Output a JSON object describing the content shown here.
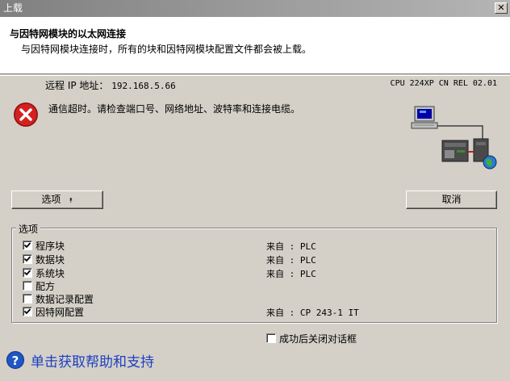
{
  "window": {
    "title": "上载",
    "close_glyph": "✕"
  },
  "header": {
    "title": "与因特网模块的以太网连接",
    "subtitle": "与因特网模块连接时，所有的块和因特网模块配置文件都会被上载。"
  },
  "connection": {
    "ip_label": "远程 IP 地址：",
    "ip_value": "192.168.5.66",
    "cpu_info": "CPU 224XP CN REL 02.01"
  },
  "error": {
    "icon": "error-icon",
    "message": "通信超时。请检查端口号、网络地址、波特率和连接电缆。"
  },
  "buttons": {
    "options_label": "选项",
    "options_arrow": "⯭",
    "cancel_label": "取消"
  },
  "options": {
    "group_label": "选项",
    "items": [
      {
        "label": "程序块",
        "checked": true,
        "from": "来自 : PLC"
      },
      {
        "label": "数据块",
        "checked": true,
        "from": "来自 : PLC"
      },
      {
        "label": "系统块",
        "checked": true,
        "from": "来自 : PLC"
      },
      {
        "label": "配方",
        "checked": false,
        "from": ""
      },
      {
        "label": "数据记录配置",
        "checked": false,
        "from": ""
      },
      {
        "label": "因特网配置",
        "checked": true,
        "from": "来自 : CP 243-1 IT"
      }
    ]
  },
  "close_after": {
    "label": "成功后关闭对话框",
    "checked": false
  },
  "help": {
    "icon_glyph": "?",
    "text": "单击获取帮助和支持"
  },
  "colors": {
    "error_red": "#d32020",
    "link_blue": "#1c3fc1",
    "title_gray": "#808080"
  }
}
